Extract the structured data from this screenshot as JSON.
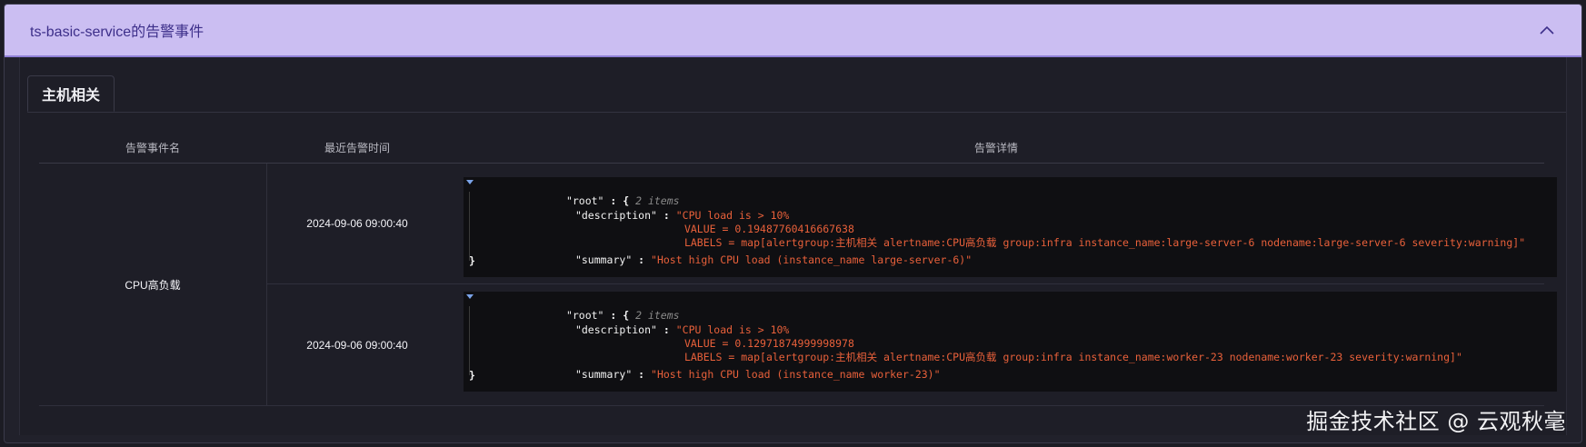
{
  "panel": {
    "title": "ts-basic-service的告警事件",
    "collapse_icon": "chevron-up-icon"
  },
  "tabs": [
    {
      "label": "主机相关",
      "active": true
    }
  ],
  "table": {
    "headers": [
      "告警事件名",
      "最近告警时间",
      "告警详情"
    ],
    "groups": [
      {
        "name": "CPU高负载",
        "rows": [
          {
            "time": "2024-09-06 09:00:40",
            "json": {
              "root_key": "\"root\"",
              "count": "2 items",
              "description_key": "\"description\"",
              "description_lines": [
                "\"CPU load is > 10%",
                "VALUE = 0.19487760416667638",
                "LABELS = map[alertgroup:主机相关 alertname:CPU高负载 group:infra instance_name:large-server-6 nodename:large-server-6 severity:warning]\""
              ],
              "summary_key": "\"summary\"",
              "summary_value": "\"Host high CPU load (instance_name large-server-6)\""
            }
          },
          {
            "time": "2024-09-06 09:00:40",
            "json": {
              "root_key": "\"root\"",
              "count": "2 items",
              "description_key": "\"description\"",
              "description_lines": [
                "\"CPU load is > 10%",
                "VALUE = 0.12971874999998978",
                "LABELS = map[alertgroup:主机相关 alertname:CPU高负载 group:infra instance_name:worker-23 nodename:worker-23 severity:warning]\""
              ],
              "summary_key": "\"summary\"",
              "summary_value": "\"Host high CPU load (instance_name worker-23)\""
            }
          }
        ]
      }
    ]
  },
  "watermark": "掘金技术社区 @ 云观秋毫",
  "colors": {
    "header_bg": "#cbbef2",
    "header_text": "#3d2f8a",
    "json_string": "#e8603a",
    "json_bg": "#0f0f12"
  }
}
